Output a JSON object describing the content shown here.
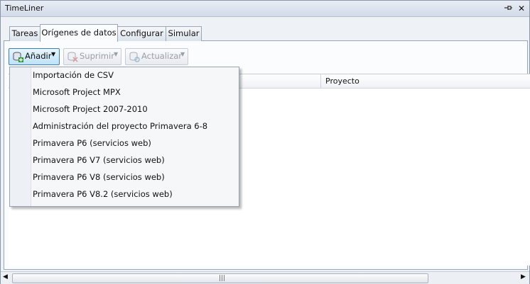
{
  "window": {
    "title": "TimeLiner"
  },
  "tabs": [
    {
      "label": "Tareas"
    },
    {
      "label": "Orígenes de datos"
    },
    {
      "label": "Configurar"
    },
    {
      "label": "Simular"
    }
  ],
  "toolbar": {
    "add_label": "Añadir",
    "delete_label": "Suprimir",
    "refresh_label": "Actualizar"
  },
  "grid": {
    "columns": [
      {
        "label": "Proyecto"
      }
    ]
  },
  "add_menu": {
    "items": [
      "Importación de CSV",
      "Microsoft Project MPX",
      "Microsoft Project 2007-2010",
      "Administración del proyecto Primavera 6-8",
      "Primavera P6 (servicios web)",
      "Primavera P6 V7 (servicios web)",
      "Primavera P6 V8 (servicios web)",
      "Primavera P6 V8.2 (servicios web)"
    ]
  },
  "icons": {
    "pin": "pin-icon",
    "close": "close-icon",
    "add": "database-add-icon",
    "delete": "database-delete-icon",
    "refresh": "database-refresh-icon"
  },
  "colors": {
    "accent": "#3c7fb1",
    "add_green": "#2e9a2e"
  }
}
